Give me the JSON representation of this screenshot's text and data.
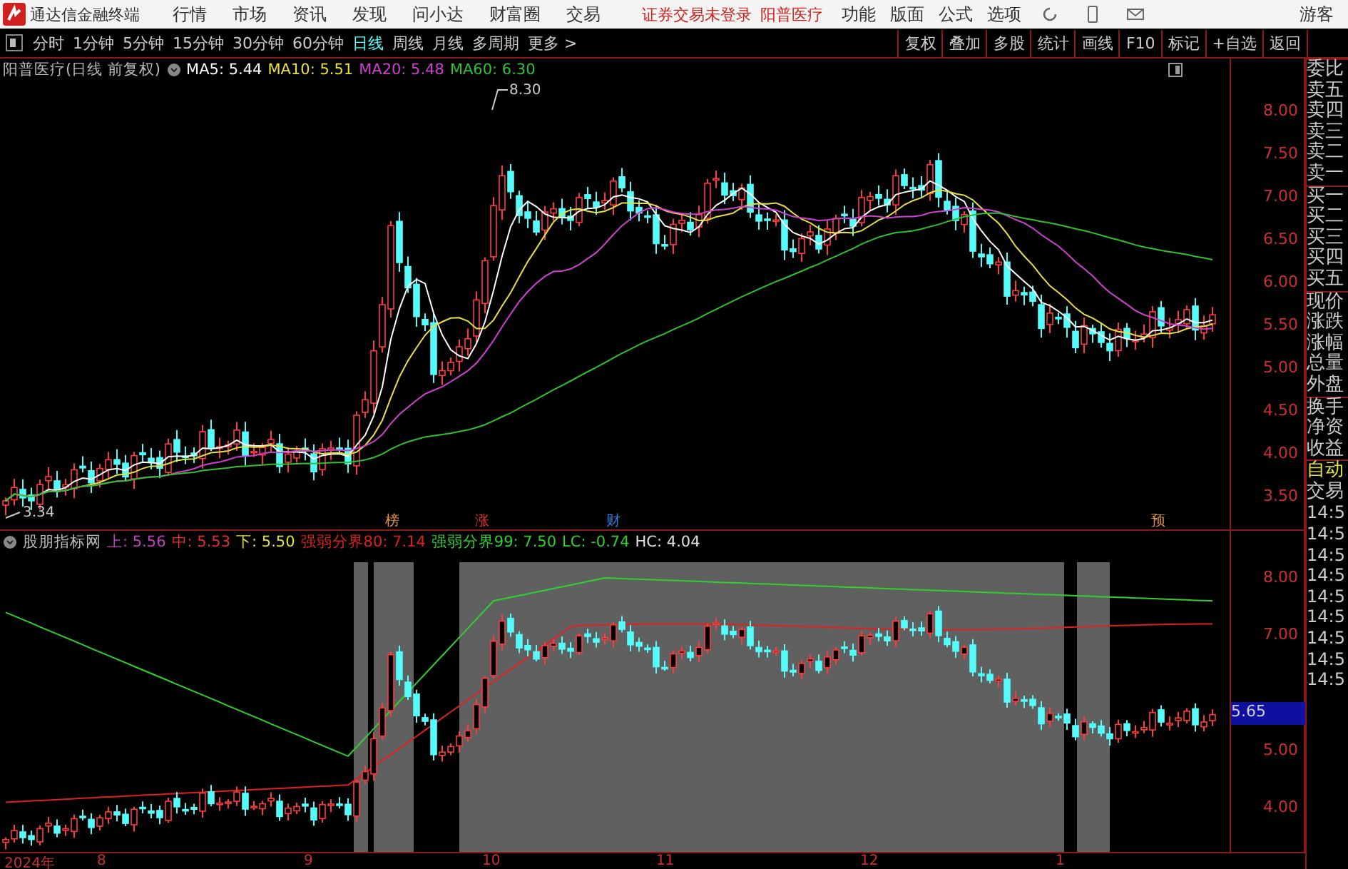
{
  "menubar": {
    "app_title": "通达信金融终端",
    "menus": [
      "行情",
      "市场",
      "资讯",
      "发现",
      "问小达",
      "财富圈",
      "交易"
    ],
    "login_status": "证券交易未登录",
    "stock_name": "阳普医疗",
    "tools": [
      "功能",
      "版面",
      "公式",
      "选项"
    ],
    "user": "游客"
  },
  "toolbar": {
    "periods": [
      {
        "label": "分时",
        "selected": false
      },
      {
        "label": "1分钟",
        "selected": false
      },
      {
        "label": "5分钟",
        "selected": false
      },
      {
        "label": "15分钟",
        "selected": false
      },
      {
        "label": "30分钟",
        "selected": false
      },
      {
        "label": "60分钟",
        "selected": false
      },
      {
        "label": "日线",
        "selected": true
      },
      {
        "label": "周线",
        "selected": false
      },
      {
        "label": "月线",
        "selected": false
      },
      {
        "label": "多周期",
        "selected": false
      }
    ],
    "more": "更多 >",
    "actions": [
      "复权",
      "叠加",
      "多股",
      "统计",
      "画线",
      "F10",
      "标记",
      "+自选",
      "返回"
    ]
  },
  "main_chart": {
    "title": "阳普医疗(日线 前复权)",
    "indicators": [
      {
        "label": "MA5: 5.44",
        "color": "#ffffff"
      },
      {
        "label": "MA10: 5.51",
        "color": "#e8e040"
      },
      {
        "label": "MA20: 5.48",
        "color": "#d040d0"
      },
      {
        "label": "MA60: 6.30",
        "color": "#30c030"
      }
    ],
    "high_label": "8.30",
    "low_label": "3.34",
    "markers": [
      {
        "text": "榜",
        "color": "#e09040"
      },
      {
        "text": "涨",
        "color": "#e03030"
      },
      {
        "text": "财",
        "color": "#3080e0"
      },
      {
        "text": "预",
        "color": "#e09040"
      }
    ],
    "y_axis": [
      "8.00",
      "7.50",
      "7.00",
      "6.50",
      "6.00",
      "5.50",
      "5.00",
      "4.50",
      "4.00",
      "3.50"
    ]
  },
  "indicator_chart": {
    "title": "股朋指标网",
    "values": [
      {
        "label": "上: 5.56",
        "color": "#c040c0"
      },
      {
        "label": "中: 5.53",
        "color": "#e03030"
      },
      {
        "label": "下: 5.50",
        "color": "#e0e040"
      },
      {
        "label": "强弱分界80: 7.14",
        "color": "#e02020"
      },
      {
        "label": "强弱分界99: 7.50",
        "color": "#30d030"
      },
      {
        "label": "LC: -0.74",
        "color": "#30d030"
      },
      {
        "label": "HC: 4.04",
        "color": "#e0e0e0"
      }
    ],
    "y_axis": [
      "8.00",
      "7.00",
      "5.00",
      "4.00"
    ],
    "price_tag": "5.65"
  },
  "date_axis": [
    "2024年",
    "8",
    "9",
    "10",
    "11",
    "12",
    "1"
  ],
  "quote_panel": {
    "labels": [
      "委比",
      "卖五",
      "卖四",
      "卖三",
      "卖二",
      "卖一",
      "买一",
      "买二",
      "买三",
      "买四",
      "买五",
      "现价",
      "涨跌",
      "涨幅",
      "总量",
      "外盘",
      "换手",
      "净资",
      "收益"
    ]
  },
  "trade_panel": {
    "mode": "自动",
    "title": "交易",
    "times": [
      "14:5",
      "14:5",
      "14:5",
      "14:5",
      "14:5",
      "14:5",
      "14:5",
      "14:5",
      "14:5"
    ]
  }
}
